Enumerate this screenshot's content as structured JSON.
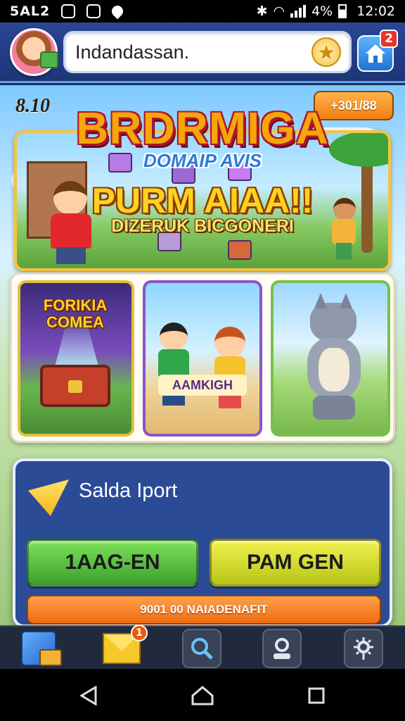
{
  "status_bar": {
    "carrier": "5AL2",
    "battery": "4%",
    "time": "12:02"
  },
  "header": {
    "search_value": "Indandassan.",
    "star_icon": "star-icon",
    "home_badge": "2"
  },
  "scene": {
    "score": "8.10",
    "coins": "+301/88",
    "title": "BRDRMIGA",
    "subtitle": "DOMAIP AVIS",
    "headline": "PURM AIAA!!",
    "headline_sub": "DIZERUK BICGONERI"
  },
  "cards": [
    {
      "label": "FORIKIA COMEA"
    },
    {
      "label": "AAMKIGH"
    },
    {
      "label": ""
    }
  ],
  "panel": {
    "title": "Salda Iport",
    "button_left": "1AAG-EN",
    "button_right": "PAM GEN",
    "button_wide": "9001 00 NAIADENAFIT"
  },
  "bottom_nav": {
    "items": [
      "cube-icon",
      "mail-icon",
      "search-icon",
      "profile-icon",
      "gear-icon"
    ],
    "mail_badge": "1"
  },
  "colors": {
    "topbar": "#2a4796",
    "panel": "#2b4b96",
    "green_button": "#3aa12c",
    "lime_button": "#d8de2a",
    "orange_button": "#ef6b10"
  }
}
